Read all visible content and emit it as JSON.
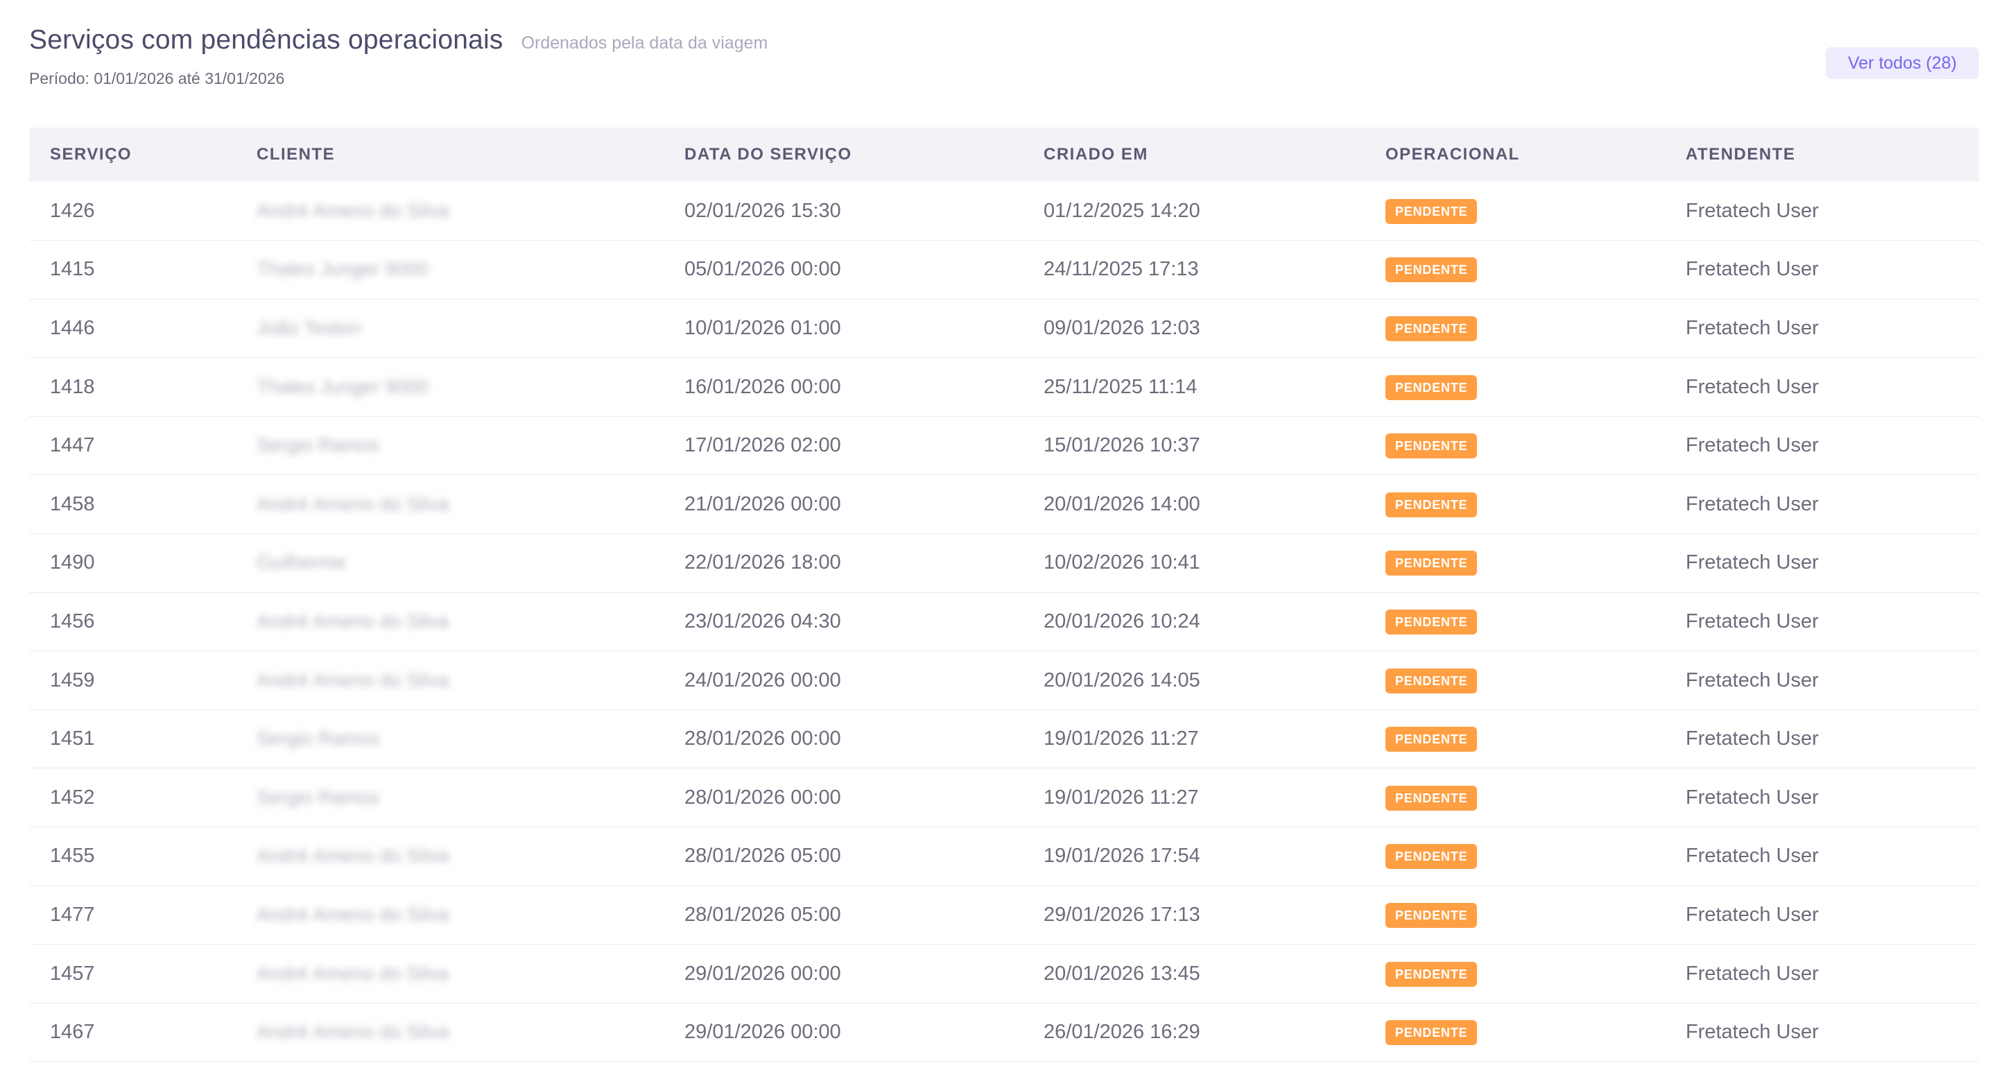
{
  "header": {
    "title": "Serviços com pendências operacionais",
    "subtitle": "Ordenados pela data da viagem",
    "period": "Período: 01/01/2026 até 31/01/2026",
    "view_all_label": "Ver todos (28)"
  },
  "table": {
    "columns": [
      "SERVIÇO",
      "CLIENTE",
      "DATA DO SERVIÇO",
      "CRIADO EM",
      "OPERACIONAL",
      "ATENDENTE"
    ],
    "rows": [
      {
        "service": "1426",
        "client": "André Ameno do Silva",
        "service_date": "02/01/2026 15:30",
        "created_at": "01/12/2025 14:20",
        "status": "PENDENTE",
        "attendant": "Fretatech User"
      },
      {
        "service": "1415",
        "client": "Thales Junger 9000",
        "service_date": "05/01/2026 00:00",
        "created_at": "24/11/2025 17:13",
        "status": "PENDENTE",
        "attendant": "Fretatech User"
      },
      {
        "service": "1446",
        "client": "João Teston",
        "service_date": "10/01/2026 01:00",
        "created_at": "09/01/2026 12:03",
        "status": "PENDENTE",
        "attendant": "Fretatech User"
      },
      {
        "service": "1418",
        "client": "Thales Junger 9000",
        "service_date": "16/01/2026 00:00",
        "created_at": "25/11/2025 11:14",
        "status": "PENDENTE",
        "attendant": "Fretatech User"
      },
      {
        "service": "1447",
        "client": "Sergio Ramos",
        "service_date": "17/01/2026 02:00",
        "created_at": "15/01/2026 10:37",
        "status": "PENDENTE",
        "attendant": "Fretatech User"
      },
      {
        "service": "1458",
        "client": "André Ameno do Silva",
        "service_date": "21/01/2026 00:00",
        "created_at": "20/01/2026 14:00",
        "status": "PENDENTE",
        "attendant": "Fretatech User"
      },
      {
        "service": "1490",
        "client": "Guilherme",
        "service_date": "22/01/2026 18:00",
        "created_at": "10/02/2026 10:41",
        "status": "PENDENTE",
        "attendant": "Fretatech User"
      },
      {
        "service": "1456",
        "client": "André Ameno do Silva",
        "service_date": "23/01/2026 04:30",
        "created_at": "20/01/2026 10:24",
        "status": "PENDENTE",
        "attendant": "Fretatech User"
      },
      {
        "service": "1459",
        "client": "André Ameno do Silva",
        "service_date": "24/01/2026 00:00",
        "created_at": "20/01/2026 14:05",
        "status": "PENDENTE",
        "attendant": "Fretatech User"
      },
      {
        "service": "1451",
        "client": "Sergio Ramos",
        "service_date": "28/01/2026 00:00",
        "created_at": "19/01/2026 11:27",
        "status": "PENDENTE",
        "attendant": "Fretatech User"
      },
      {
        "service": "1452",
        "client": "Sergio Ramos",
        "service_date": "28/01/2026 00:00",
        "created_at": "19/01/2026 11:27",
        "status": "PENDENTE",
        "attendant": "Fretatech User"
      },
      {
        "service": "1455",
        "client": "André Ameno do Silva",
        "service_date": "28/01/2026 05:00",
        "created_at": "19/01/2026 17:54",
        "status": "PENDENTE",
        "attendant": "Fretatech User"
      },
      {
        "service": "1477",
        "client": "André Ameno do Silva",
        "service_date": "28/01/2026 05:00",
        "created_at": "29/01/2026 17:13",
        "status": "PENDENTE",
        "attendant": "Fretatech User"
      },
      {
        "service": "1457",
        "client": "André Ameno do Silva",
        "service_date": "29/01/2026 00:00",
        "created_at": "20/01/2026 13:45",
        "status": "PENDENTE",
        "attendant": "Fretatech User"
      },
      {
        "service": "1467",
        "client": "André Ameno do Silva",
        "service_date": "29/01/2026 00:00",
        "created_at": "26/01/2026 16:29",
        "status": "PENDENTE",
        "attendant": "Fretatech User"
      }
    ]
  },
  "colors": {
    "badge_pending": "#ff9f43",
    "accent": "#7367f0",
    "header_bg": "#f3f2f7"
  }
}
